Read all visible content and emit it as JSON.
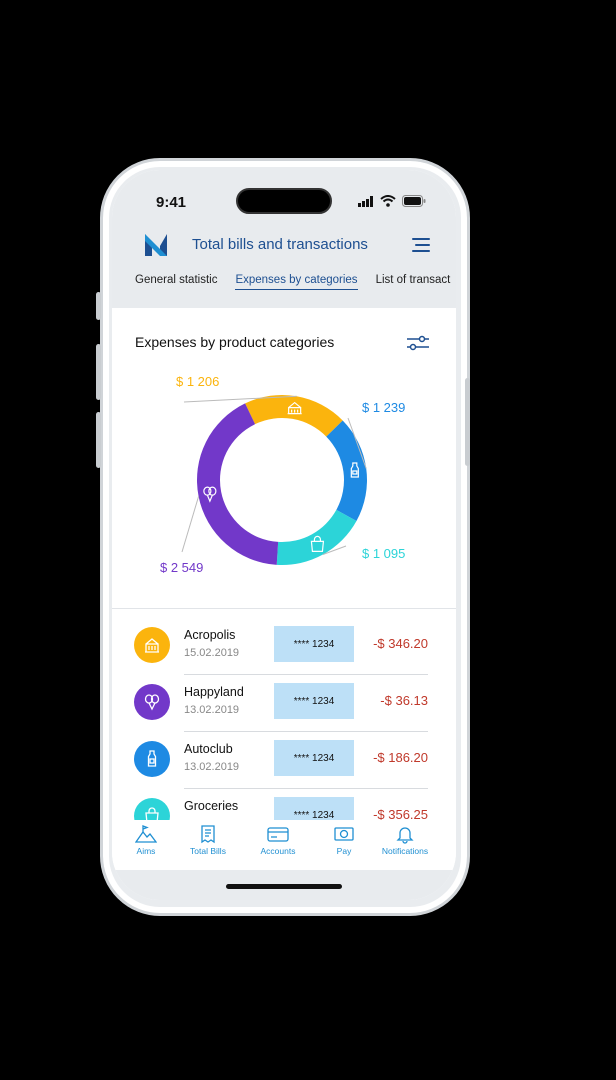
{
  "status": {
    "time": "9:41"
  },
  "header": {
    "title": "Total bills and transactions"
  },
  "tabs": [
    {
      "label": "General statistic"
    },
    {
      "label": "Expenses by categories"
    },
    {
      "label": "List of transact"
    }
  ],
  "section": {
    "title": "Expenses by product categories"
  },
  "chart_data": {
    "type": "pie",
    "title": "Expenses by product categories",
    "slices": [
      {
        "label": "$ 1 206",
        "value": 1206,
        "color": "#fbb40d",
        "icon": "building-icon"
      },
      {
        "label": "$ 1 239",
        "value": 1239,
        "color": "#1e8ae3",
        "icon": "bottle-icon"
      },
      {
        "label": "$ 1 095",
        "value": 1095,
        "color": "#2cd4d8",
        "icon": "shopping-bag-icon"
      },
      {
        "label": "$ 2 549",
        "value": 2549,
        "color": "#7238c9",
        "icon": "balloons-icon"
      }
    ]
  },
  "transactions": [
    {
      "name": "Acropolis",
      "date": "15.02.2019",
      "card": "**** 1234",
      "amount": "-$ 346.20",
      "color": "#fbb40d",
      "icon": "building-icon"
    },
    {
      "name": "Happyland",
      "date": "13.02.2019",
      "card": "**** 1234",
      "amount": "-$ 36.13",
      "color": "#7238c9",
      "icon": "balloons-icon"
    },
    {
      "name": "Autoclub",
      "date": "13.02.2019",
      "card": "**** 1234",
      "amount": "-$ 186.20",
      "color": "#1e8ae3",
      "icon": "bottle-icon"
    },
    {
      "name": "Groceries",
      "date": "",
      "card": "**** 1234",
      "amount": "-$ 356.25",
      "color": "#2cd4d8",
      "icon": "shopping-bag-icon"
    }
  ],
  "nav": [
    {
      "label": "Aims",
      "icon": "mountain-flag-icon"
    },
    {
      "label": "Total Bills",
      "icon": "bill-icon"
    },
    {
      "label": "Accounts",
      "icon": "card-icon"
    },
    {
      "label": "Pay",
      "icon": "dollar-bill-icon"
    },
    {
      "label": "Notifications",
      "icon": "bell-icon"
    }
  ]
}
